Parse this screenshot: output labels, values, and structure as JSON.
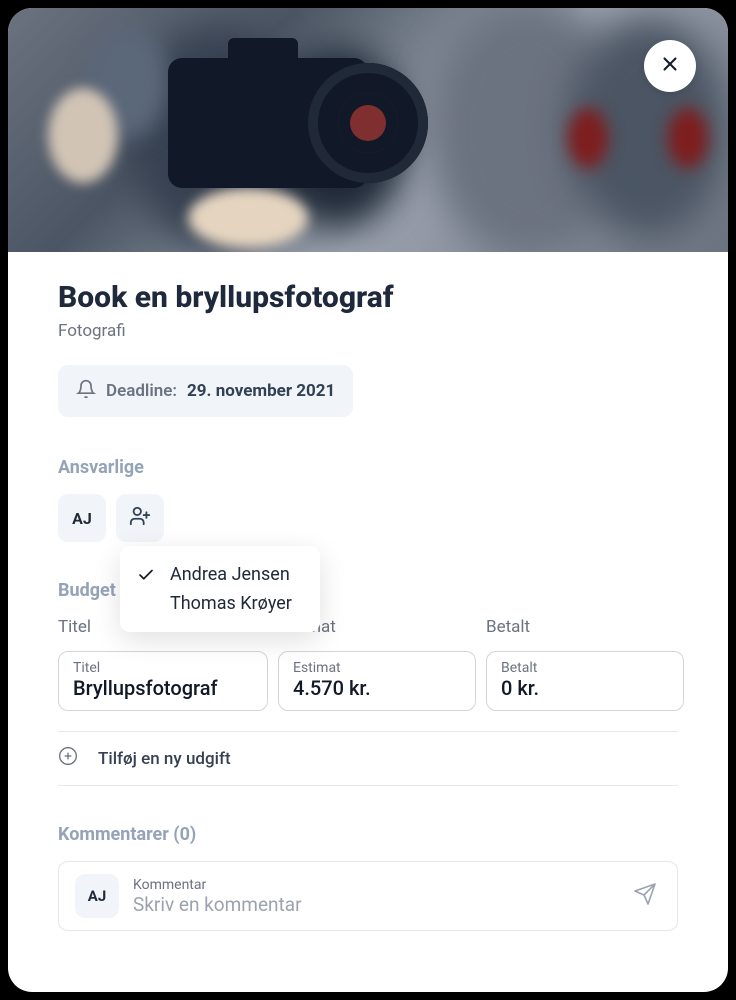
{
  "title": "Book en bryllupsfotograf",
  "category": "Fotografi",
  "deadline": {
    "label": "Deadline:",
    "value": "29. november 2021"
  },
  "sections": {
    "assignees": "Ansvarlige",
    "budget": "Budget",
    "comments": "Kommentarer (0)"
  },
  "avatar_initials": "AJ",
  "assignee_options": [
    {
      "name": "Andrea Jensen",
      "selected": true
    },
    {
      "name": "Thomas Krøyer",
      "selected": false
    }
  ],
  "budget": {
    "columns": {
      "title": "Titel",
      "estimate": "Estimat",
      "paid": "Betalt"
    },
    "row": {
      "title_label": "Titel",
      "title_value": "Bryllupsfotograf",
      "estimate_label": "Estimat",
      "estimate_value": "4.570 kr.",
      "paid_label": "Betalt",
      "paid_value": "0 kr."
    },
    "add_label": "Tilføj en ny udgift"
  },
  "comment": {
    "field_label": "Kommentar",
    "placeholder": "Skriv en kommentar",
    "avatar": "AJ"
  }
}
